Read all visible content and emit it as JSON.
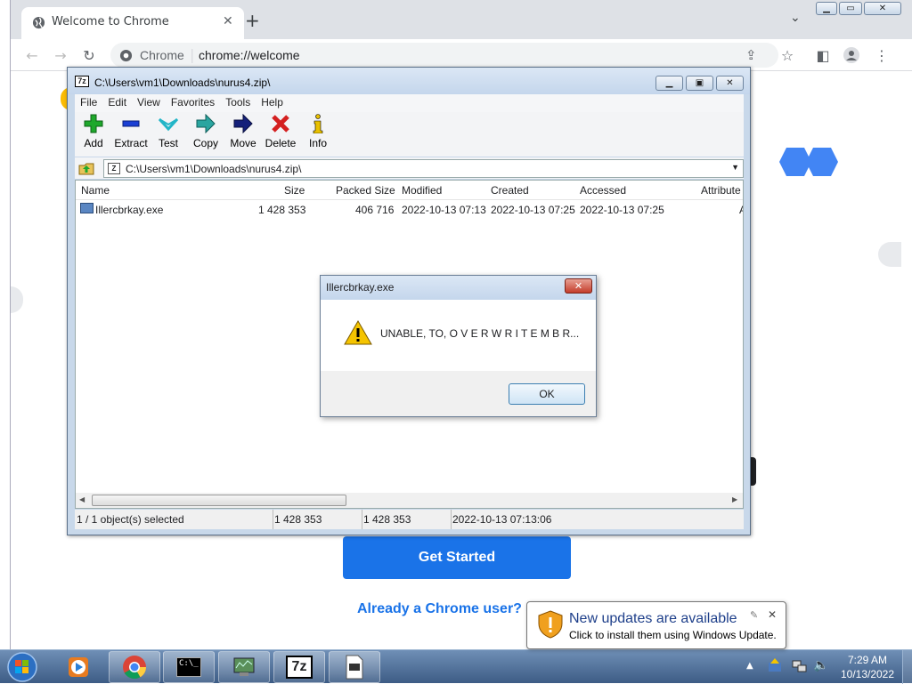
{
  "chrome": {
    "tab_title": "Welcome to Chrome",
    "site_chip": "Chrome",
    "url": "chrome://welcome",
    "get_started": "Get Started",
    "already_user": "Already a Chrome user? Si"
  },
  "sevenzip": {
    "title": "C:\\Users\\vm1\\Downloads\\nurus4.zip\\",
    "menu": [
      "File",
      "Edit",
      "View",
      "Favorites",
      "Tools",
      "Help"
    ],
    "tools": [
      "Add",
      "Extract",
      "Test",
      "Copy",
      "Move",
      "Delete",
      "Info"
    ],
    "address": "C:\\Users\\vm1\\Downloads\\nurus4.zip\\",
    "columns": [
      "Name",
      "Size",
      "Packed Size",
      "Modified",
      "Created",
      "Accessed",
      "Attribute"
    ],
    "rows": [
      {
        "name": "Illercbrkay.exe",
        "size": "1 428 353",
        "packed": "406 716",
        "modified": "2022-10-13 07:13",
        "created": "2022-10-13 07:25",
        "accessed": "2022-10-13 07:25",
        "attr": "A"
      }
    ],
    "status": {
      "selected": "1 / 1 object(s) selected",
      "size": "1 428 353",
      "packed": "1 428 353",
      "date": "2022-10-13 07:13:06"
    }
  },
  "dialog": {
    "title": "Illercbrkay.exe",
    "message": "UNABLE, TO, O V E R W R I T E M B R...",
    "ok": "OK"
  },
  "balloon": {
    "title": "New updates are available",
    "text": "Click to install them using Windows Update."
  },
  "clock": {
    "time": "7:29 AM",
    "date": "10/13/2022"
  },
  "colors": {
    "chrome_blue": "#1a73e8",
    "delete_red": "#d42020",
    "add_green": "#1fa82c"
  }
}
